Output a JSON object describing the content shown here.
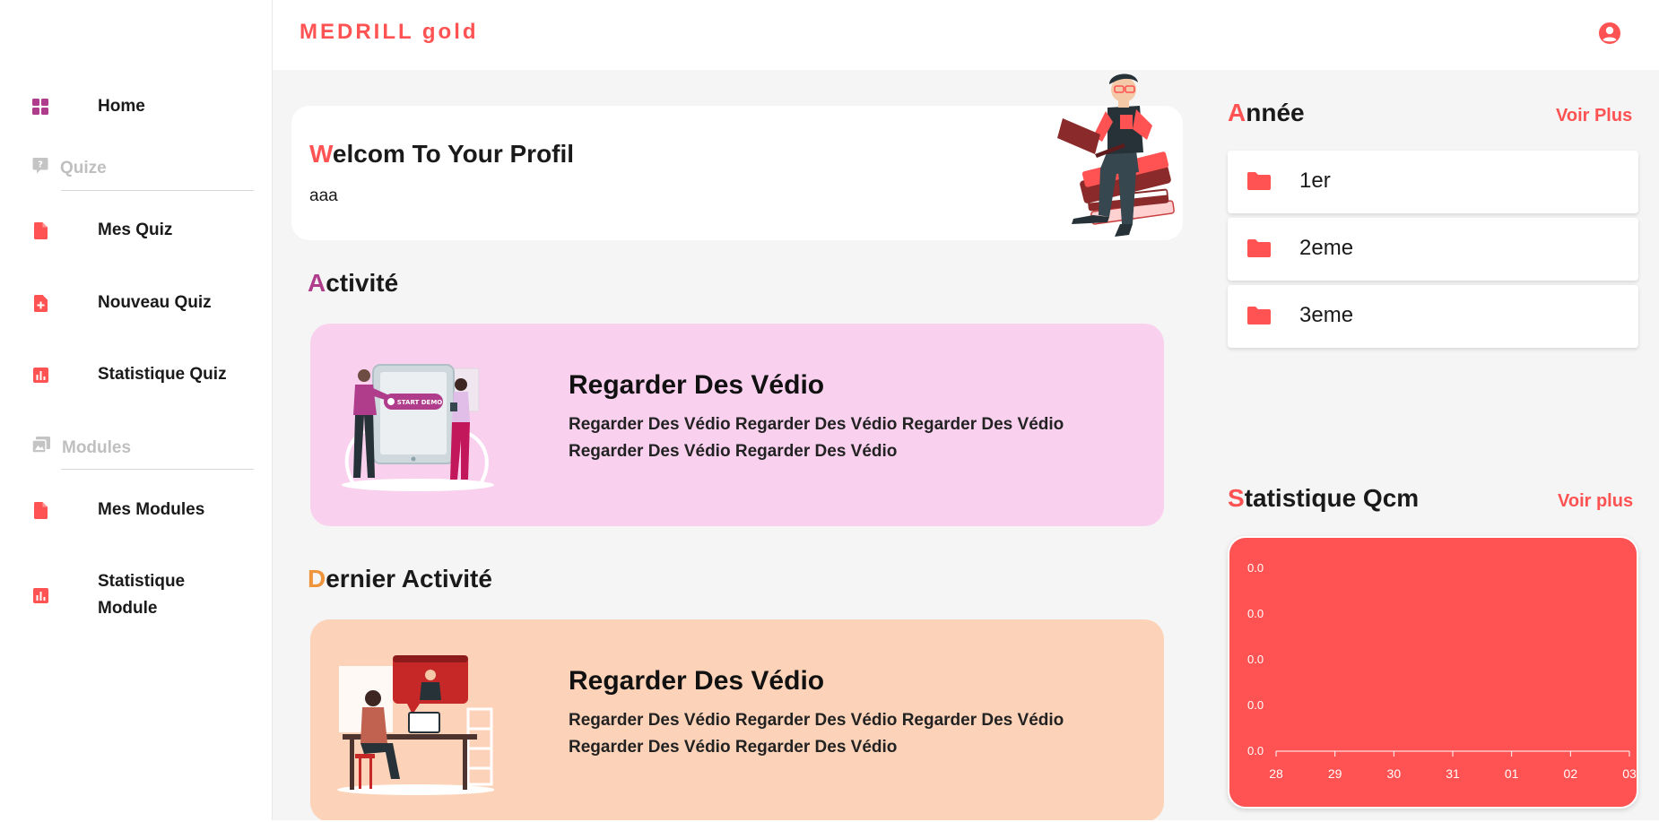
{
  "brand": "MEDRILL gold",
  "sidebar": {
    "home_label": "Home",
    "quize_section": "Quize",
    "modules_section": "Modules",
    "items": [
      {
        "label": "Mes Quiz"
      },
      {
        "label": "Nouveau Quiz"
      },
      {
        "label": "Statistique Quiz"
      },
      {
        "label": "Mes Modules"
      },
      {
        "label": "Statistique Module"
      }
    ]
  },
  "welcome": {
    "title_first": "W",
    "title_rest": "elcom To Your Profil",
    "subtitle": "aaa"
  },
  "activite": {
    "title_first": "A",
    "title_rest": "ctivité",
    "card_title": "Regarder Des Védio",
    "card_desc": "Regarder Des Védio Regarder Des Védio Regarder Des Védio Regarder Des Védio Regarder Des Védio",
    "illustration_label": "START DEMO"
  },
  "dernier": {
    "title_first": "D",
    "title_rest": "ernier Activité",
    "card_title": "Regarder Des Védio",
    "card_desc": "Regarder Des Védio Regarder Des Védio Regarder Des Védio Regarder Des Védio Regarder Des Védio"
  },
  "annee": {
    "title_first": "A",
    "title_rest": "nnée",
    "voir_label": "Voir Plus",
    "years": [
      "1er",
      "2eme",
      "3eme"
    ]
  },
  "stat_qcm": {
    "title_first": "S",
    "title_rest": "tatistique Qcm",
    "voir_label": "Voir plus"
  },
  "colors": {
    "accent": "#ff5252",
    "activite_accent": "#b03c8c",
    "dernier_accent": "#f0943c",
    "activite_bg": "#f9d1ef",
    "dernier_bg": "#fcd3b8"
  },
  "chart_data": {
    "type": "line",
    "title": "",
    "xlabel": "",
    "ylabel": "",
    "categories": [
      "28",
      "29",
      "30",
      "31",
      "01",
      "02",
      "03"
    ],
    "y_tick_labels": [
      "0.0",
      "0.0",
      "0.0",
      "0.0",
      "0.0"
    ],
    "series": [
      {
        "values": [
          0,
          0,
          0,
          0,
          0,
          0,
          0
        ]
      }
    ],
    "ylim": [
      0,
      0
    ],
    "grid": false
  }
}
